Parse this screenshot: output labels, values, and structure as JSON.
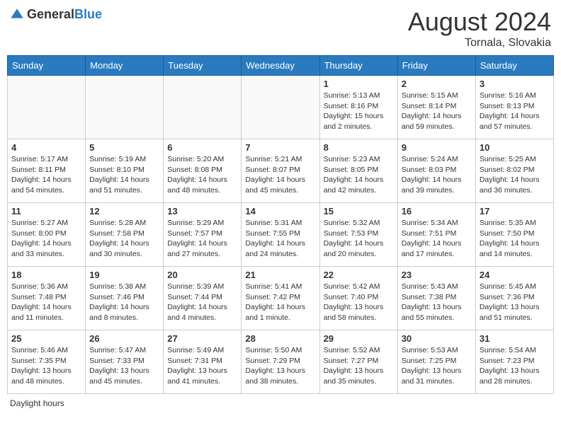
{
  "header": {
    "logo_general": "General",
    "logo_blue": "Blue",
    "month_year": "August 2024",
    "location": "Tornala, Slovakia"
  },
  "days_of_week": [
    "Sunday",
    "Monday",
    "Tuesday",
    "Wednesday",
    "Thursday",
    "Friday",
    "Saturday"
  ],
  "footer": {
    "note": "Daylight hours"
  },
  "weeks": [
    [
      {
        "day": "",
        "sunrise": "",
        "sunset": "",
        "daylight": ""
      },
      {
        "day": "",
        "sunrise": "",
        "sunset": "",
        "daylight": ""
      },
      {
        "day": "",
        "sunrise": "",
        "sunset": "",
        "daylight": ""
      },
      {
        "day": "",
        "sunrise": "",
        "sunset": "",
        "daylight": ""
      },
      {
        "day": "1",
        "sunrise": "Sunrise: 5:13 AM",
        "sunset": "Sunset: 8:16 PM",
        "daylight": "Daylight: 15 hours and 2 minutes."
      },
      {
        "day": "2",
        "sunrise": "Sunrise: 5:15 AM",
        "sunset": "Sunset: 8:14 PM",
        "daylight": "Daylight: 14 hours and 59 minutes."
      },
      {
        "day": "3",
        "sunrise": "Sunrise: 5:16 AM",
        "sunset": "Sunset: 8:13 PM",
        "daylight": "Daylight: 14 hours and 57 minutes."
      }
    ],
    [
      {
        "day": "4",
        "sunrise": "Sunrise: 5:17 AM",
        "sunset": "Sunset: 8:11 PM",
        "daylight": "Daylight: 14 hours and 54 minutes."
      },
      {
        "day": "5",
        "sunrise": "Sunrise: 5:19 AM",
        "sunset": "Sunset: 8:10 PM",
        "daylight": "Daylight: 14 hours and 51 minutes."
      },
      {
        "day": "6",
        "sunrise": "Sunrise: 5:20 AM",
        "sunset": "Sunset: 8:08 PM",
        "daylight": "Daylight: 14 hours and 48 minutes."
      },
      {
        "day": "7",
        "sunrise": "Sunrise: 5:21 AM",
        "sunset": "Sunset: 8:07 PM",
        "daylight": "Daylight: 14 hours and 45 minutes."
      },
      {
        "day": "8",
        "sunrise": "Sunrise: 5:23 AM",
        "sunset": "Sunset: 8:05 PM",
        "daylight": "Daylight: 14 hours and 42 minutes."
      },
      {
        "day": "9",
        "sunrise": "Sunrise: 5:24 AM",
        "sunset": "Sunset: 8:03 PM",
        "daylight": "Daylight: 14 hours and 39 minutes."
      },
      {
        "day": "10",
        "sunrise": "Sunrise: 5:25 AM",
        "sunset": "Sunset: 8:02 PM",
        "daylight": "Daylight: 14 hours and 36 minutes."
      }
    ],
    [
      {
        "day": "11",
        "sunrise": "Sunrise: 5:27 AM",
        "sunset": "Sunset: 8:00 PM",
        "daylight": "Daylight: 14 hours and 33 minutes."
      },
      {
        "day": "12",
        "sunrise": "Sunrise: 5:28 AM",
        "sunset": "Sunset: 7:58 PM",
        "daylight": "Daylight: 14 hours and 30 minutes."
      },
      {
        "day": "13",
        "sunrise": "Sunrise: 5:29 AM",
        "sunset": "Sunset: 7:57 PM",
        "daylight": "Daylight: 14 hours and 27 minutes."
      },
      {
        "day": "14",
        "sunrise": "Sunrise: 5:31 AM",
        "sunset": "Sunset: 7:55 PM",
        "daylight": "Daylight: 14 hours and 24 minutes."
      },
      {
        "day": "15",
        "sunrise": "Sunrise: 5:32 AM",
        "sunset": "Sunset: 7:53 PM",
        "daylight": "Daylight: 14 hours and 20 minutes."
      },
      {
        "day": "16",
        "sunrise": "Sunrise: 5:34 AM",
        "sunset": "Sunset: 7:51 PM",
        "daylight": "Daylight: 14 hours and 17 minutes."
      },
      {
        "day": "17",
        "sunrise": "Sunrise: 5:35 AM",
        "sunset": "Sunset: 7:50 PM",
        "daylight": "Daylight: 14 hours and 14 minutes."
      }
    ],
    [
      {
        "day": "18",
        "sunrise": "Sunrise: 5:36 AM",
        "sunset": "Sunset: 7:48 PM",
        "daylight": "Daylight: 14 hours and 11 minutes."
      },
      {
        "day": "19",
        "sunrise": "Sunrise: 5:38 AM",
        "sunset": "Sunset: 7:46 PM",
        "daylight": "Daylight: 14 hours and 8 minutes."
      },
      {
        "day": "20",
        "sunrise": "Sunrise: 5:39 AM",
        "sunset": "Sunset: 7:44 PM",
        "daylight": "Daylight: 14 hours and 4 minutes."
      },
      {
        "day": "21",
        "sunrise": "Sunrise: 5:41 AM",
        "sunset": "Sunset: 7:42 PM",
        "daylight": "Daylight: 14 hours and 1 minute."
      },
      {
        "day": "22",
        "sunrise": "Sunrise: 5:42 AM",
        "sunset": "Sunset: 7:40 PM",
        "daylight": "Daylight: 13 hours and 58 minutes."
      },
      {
        "day": "23",
        "sunrise": "Sunrise: 5:43 AM",
        "sunset": "Sunset: 7:38 PM",
        "daylight": "Daylight: 13 hours and 55 minutes."
      },
      {
        "day": "24",
        "sunrise": "Sunrise: 5:45 AM",
        "sunset": "Sunset: 7:36 PM",
        "daylight": "Daylight: 13 hours and 51 minutes."
      }
    ],
    [
      {
        "day": "25",
        "sunrise": "Sunrise: 5:46 AM",
        "sunset": "Sunset: 7:35 PM",
        "daylight": "Daylight: 13 hours and 48 minutes."
      },
      {
        "day": "26",
        "sunrise": "Sunrise: 5:47 AM",
        "sunset": "Sunset: 7:33 PM",
        "daylight": "Daylight: 13 hours and 45 minutes."
      },
      {
        "day": "27",
        "sunrise": "Sunrise: 5:49 AM",
        "sunset": "Sunset: 7:31 PM",
        "daylight": "Daylight: 13 hours and 41 minutes."
      },
      {
        "day": "28",
        "sunrise": "Sunrise: 5:50 AM",
        "sunset": "Sunset: 7:29 PM",
        "daylight": "Daylight: 13 hours and 38 minutes."
      },
      {
        "day": "29",
        "sunrise": "Sunrise: 5:52 AM",
        "sunset": "Sunset: 7:27 PM",
        "daylight": "Daylight: 13 hours and 35 minutes."
      },
      {
        "day": "30",
        "sunrise": "Sunrise: 5:53 AM",
        "sunset": "Sunset: 7:25 PM",
        "daylight": "Daylight: 13 hours and 31 minutes."
      },
      {
        "day": "31",
        "sunrise": "Sunrise: 5:54 AM",
        "sunset": "Sunset: 7:23 PM",
        "daylight": "Daylight: 13 hours and 28 minutes."
      }
    ]
  ]
}
